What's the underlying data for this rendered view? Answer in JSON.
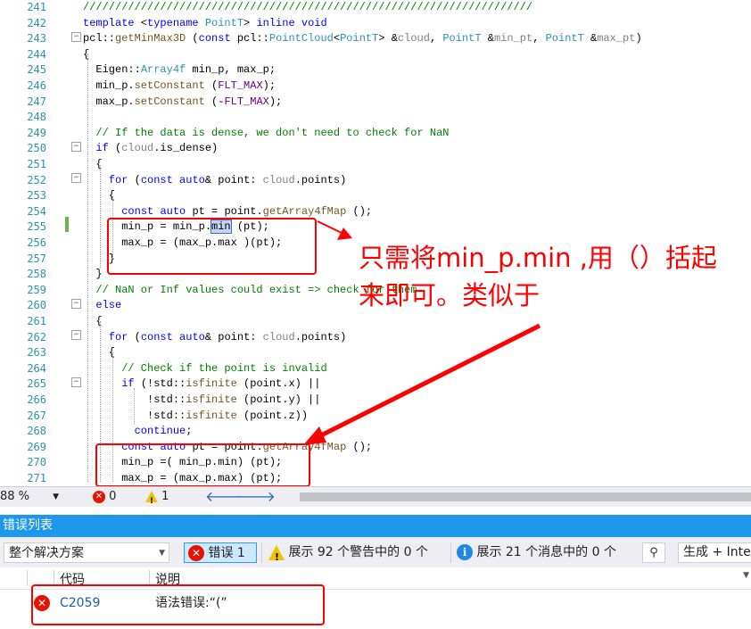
{
  "editor": {
    "lines": [
      {
        "n": "241",
        "tokens": [
          {
            "c": "cm",
            "t": "//////////////////////////////////////////////////////////////////////"
          }
        ]
      },
      {
        "n": "242",
        "tokens": [
          {
            "c": "kw",
            "t": "template"
          },
          {
            "c": "",
            "t": " <"
          },
          {
            "c": "kw",
            "t": "typename"
          },
          {
            "c": "",
            "t": " "
          },
          {
            "c": "ty",
            "t": "PointT"
          },
          {
            "c": "",
            "t": "> "
          },
          {
            "c": "kw",
            "t": "inline"
          },
          {
            "c": "",
            "t": " "
          },
          {
            "c": "kw",
            "t": "void"
          }
        ]
      },
      {
        "n": "243",
        "tokens": [
          {
            "c": "",
            "t": "pcl::"
          },
          {
            "c": "fn",
            "t": "getMinMax3D"
          },
          {
            "c": "",
            "t": " ("
          },
          {
            "c": "kw",
            "t": "const"
          },
          {
            "c": "",
            "t": " pcl::"
          },
          {
            "c": "ty",
            "t": "PointCloud"
          },
          {
            "c": "",
            "t": "<"
          },
          {
            "c": "ty",
            "t": "PointT"
          },
          {
            "c": "",
            "t": "> &"
          },
          {
            "c": "pm",
            "t": "cloud"
          },
          {
            "c": "",
            "t": ", "
          },
          {
            "c": "ty",
            "t": "PointT"
          },
          {
            "c": "",
            "t": " &"
          },
          {
            "c": "pm",
            "t": "min_pt"
          },
          {
            "c": "",
            "t": ", "
          },
          {
            "c": "ty",
            "t": "PointT"
          },
          {
            "c": "",
            "t": " &"
          },
          {
            "c": "pm",
            "t": "max_pt"
          },
          {
            "c": "",
            "t": ")"
          }
        ]
      },
      {
        "n": "244",
        "tokens": [
          {
            "c": "",
            "t": "{"
          }
        ]
      },
      {
        "n": "245",
        "tokens": [
          {
            "c": "",
            "t": "  Eigen::"
          },
          {
            "c": "ty",
            "t": "Array4f"
          },
          {
            "c": "",
            "t": " min_p, max_p;"
          }
        ]
      },
      {
        "n": "246",
        "tokens": [
          {
            "c": "",
            "t": "  min_p."
          },
          {
            "c": "fn",
            "t": "setConstant"
          },
          {
            "c": "",
            "t": " ("
          },
          {
            "c": "mc",
            "t": "FLT_MAX"
          },
          {
            "c": "",
            "t": ");"
          }
        ]
      },
      {
        "n": "247",
        "tokens": [
          {
            "c": "",
            "t": "  max_p."
          },
          {
            "c": "fn",
            "t": "setConstant"
          },
          {
            "c": "",
            "t": " (-"
          },
          {
            "c": "mc",
            "t": "FLT_MAX"
          },
          {
            "c": "",
            "t": ");"
          }
        ]
      },
      {
        "n": "248",
        "tokens": []
      },
      {
        "n": "249",
        "tokens": [
          {
            "c": "cm",
            "t": "  // If the data is dense, we don't need to check for NaN"
          }
        ]
      },
      {
        "n": "250",
        "tokens": [
          {
            "c": "",
            "t": "  "
          },
          {
            "c": "kw",
            "t": "if"
          },
          {
            "c": "",
            "t": " ("
          },
          {
            "c": "pm",
            "t": "cloud"
          },
          {
            "c": "",
            "t": ".is_dense)"
          }
        ]
      },
      {
        "n": "251",
        "tokens": [
          {
            "c": "",
            "t": "  {"
          }
        ]
      },
      {
        "n": "252",
        "tokens": [
          {
            "c": "",
            "t": "    "
          },
          {
            "c": "kw",
            "t": "for"
          },
          {
            "c": "",
            "t": " ("
          },
          {
            "c": "kw",
            "t": "const"
          },
          {
            "c": "",
            "t": " "
          },
          {
            "c": "kw",
            "t": "auto"
          },
          {
            "c": "",
            "t": "& point: "
          },
          {
            "c": "pm",
            "t": "cloud"
          },
          {
            "c": "",
            "t": ".points)"
          }
        ]
      },
      {
        "n": "253",
        "tokens": [
          {
            "c": "",
            "t": "    {"
          }
        ]
      },
      {
        "n": "254",
        "tokens": [
          {
            "c": "",
            "t": "      "
          },
          {
            "c": "kw",
            "t": "const"
          },
          {
            "c": "",
            "t": " "
          },
          {
            "c": "kw",
            "t": "auto"
          },
          {
            "c": "",
            "t": " pt = point."
          },
          {
            "c": "fn",
            "t": "getArray4fMap"
          },
          {
            "c": "",
            "t": " ();"
          }
        ]
      },
      {
        "n": "255",
        "tokens": [
          {
            "c": "",
            "t": "      min_p = min_p."
          },
          {
            "c": "hl",
            "t": "min"
          },
          {
            "c": "",
            "t": " (pt);"
          }
        ]
      },
      {
        "n": "256",
        "tokens": [
          {
            "c": "",
            "t": "      max_p = (max_p.max )(pt);"
          }
        ]
      },
      {
        "n": "257",
        "tokens": [
          {
            "c": "",
            "t": "    }"
          }
        ]
      },
      {
        "n": "258",
        "tokens": [
          {
            "c": "",
            "t": "  }"
          }
        ]
      },
      {
        "n": "259",
        "tokens": [
          {
            "c": "cm",
            "t": "  // NaN or Inf values could exist => check for them"
          }
        ]
      },
      {
        "n": "260",
        "tokens": [
          {
            "c": "",
            "t": "  "
          },
          {
            "c": "kw",
            "t": "else"
          }
        ]
      },
      {
        "n": "261",
        "tokens": [
          {
            "c": "",
            "t": "  {"
          }
        ]
      },
      {
        "n": "262",
        "tokens": [
          {
            "c": "",
            "t": "    "
          },
          {
            "c": "kw",
            "t": "for"
          },
          {
            "c": "",
            "t": " ("
          },
          {
            "c": "kw",
            "t": "const"
          },
          {
            "c": "",
            "t": " "
          },
          {
            "c": "kw",
            "t": "auto"
          },
          {
            "c": "",
            "t": "& point: "
          },
          {
            "c": "pm",
            "t": "cloud"
          },
          {
            "c": "",
            "t": ".points)"
          }
        ]
      },
      {
        "n": "263",
        "tokens": [
          {
            "c": "",
            "t": "    {"
          }
        ]
      },
      {
        "n": "264",
        "tokens": [
          {
            "c": "cm",
            "t": "      // Check if the point is invalid"
          }
        ]
      },
      {
        "n": "265",
        "tokens": [
          {
            "c": "",
            "t": "      "
          },
          {
            "c": "kw",
            "t": "if"
          },
          {
            "c": "",
            "t": " (!std::"
          },
          {
            "c": "fn",
            "t": "isfinite"
          },
          {
            "c": "",
            "t": " (point.x) ||"
          }
        ]
      },
      {
        "n": "266",
        "tokens": [
          {
            "c": "",
            "t": "          !std::"
          },
          {
            "c": "fn",
            "t": "isfinite"
          },
          {
            "c": "",
            "t": " (point.y) ||"
          }
        ]
      },
      {
        "n": "267",
        "tokens": [
          {
            "c": "",
            "t": "          !std::"
          },
          {
            "c": "fn",
            "t": "isfinite"
          },
          {
            "c": "",
            "t": " (point.z))"
          }
        ]
      },
      {
        "n": "268",
        "tokens": [
          {
            "c": "",
            "t": "        "
          },
          {
            "c": "kw",
            "t": "continue"
          },
          {
            "c": "",
            "t": ";"
          }
        ]
      },
      {
        "n": "269",
        "tokens": [
          {
            "c": "",
            "t": "      "
          },
          {
            "c": "kw",
            "t": "const"
          },
          {
            "c": "",
            "t": " "
          },
          {
            "c": "kw",
            "t": "auto"
          },
          {
            "c": "",
            "t": " pt = point."
          },
          {
            "c": "fn",
            "t": "getArray4fMap"
          },
          {
            "c": "",
            "t": " ();"
          }
        ]
      },
      {
        "n": "270",
        "tokens": [
          {
            "c": "",
            "t": "      min_p =( min_p.min) (pt);"
          }
        ]
      },
      {
        "n": "271",
        "tokens": [
          {
            "c": "",
            "t": "      max_p = (max_p.max) (pt);"
          }
        ]
      }
    ]
  },
  "annotation": {
    "text": "只需将min_p.min ,用（）括起来即可。类似于"
  },
  "statusbar": {
    "zoom": "88 %",
    "errors": "0",
    "warnings": "1"
  },
  "error_list": {
    "title": "错误列表",
    "scope": "整个解决方案",
    "errors_button": "错误 1",
    "warnings_button": "展示 92 个警告中的 0 个",
    "messages_button": "展示 21 个消息中的 0 个",
    "build_filter": "生成 + IntelliSense",
    "columns": {
      "code": "代码",
      "description": "说明"
    },
    "rows": [
      {
        "code": "C2059",
        "description": "语法错误:“(”"
      }
    ]
  },
  "colors": {
    "accent": "#1c97ea",
    "annotation_red": "#ff0000",
    "error_red": "#e51400"
  }
}
